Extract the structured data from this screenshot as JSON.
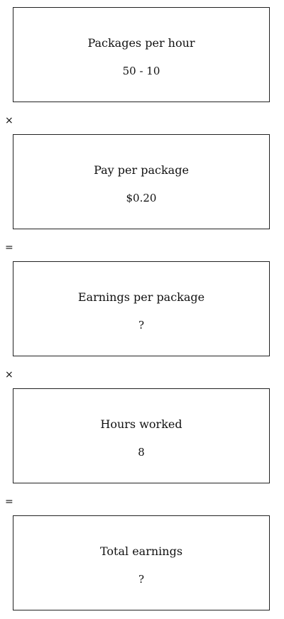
{
  "steps": [
    {
      "label": "Packages per hour",
      "value": "50 - 10"
    },
    {
      "label": "Pay per package",
      "value": "$0.20"
    },
    {
      "label": "Earnings per package",
      "value": "?"
    },
    {
      "label": "Hours worked",
      "value": "8"
    },
    {
      "label": "Total earnings",
      "value": "?"
    }
  ],
  "operators": [
    "×",
    "=",
    "×",
    "="
  ]
}
